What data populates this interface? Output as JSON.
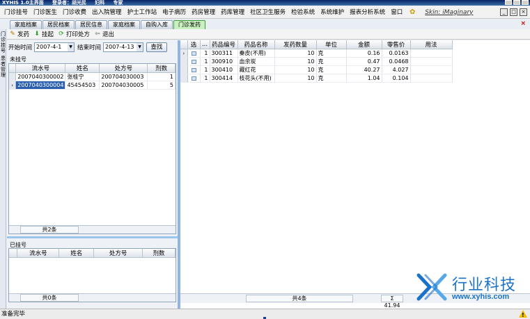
{
  "window": {
    "title": "XYHIS 1.0主界面",
    "user": "登录者：胡光民",
    "dept": "妇科",
    "role": "专家"
  },
  "menu": [
    "门诊挂号",
    "门诊医生",
    "门诊收费",
    "出入院管理",
    "护士工作站",
    "电子病历",
    "药房管理",
    "药库管理",
    "社区卫生服务",
    "检验系统",
    "系统维护",
    "报表分析系统",
    "窗口"
  ],
  "skin": "Skin: iMaginary",
  "tabs": [
    "家庭档案",
    "居民档案",
    "居民信息",
    "家庭档案",
    "自购入库",
    "门诊发药"
  ],
  "leftstrip": [
    "门诊挂号",
    "患者管理"
  ],
  "toolbar": {
    "dispense": "发药",
    "hold": "挂起",
    "print": "打印处方",
    "exit": "退出"
  },
  "search": {
    "start_label": "开始时间",
    "start_value": "2007-4-1",
    "end_label": "结束时间",
    "end_value": "2007-4-13",
    "button": "查找"
  },
  "unregistered": {
    "title": "未挂号",
    "columns": [
      "流水号",
      "姓名",
      "处方号",
      "剂数"
    ],
    "rows": [
      [
        "2007040300002",
        "张桂宁",
        "200704030003",
        "1"
      ],
      [
        "2007040300004",
        "45454503",
        "200704030005",
        "5"
      ]
    ],
    "count": "共2条"
  },
  "registered": {
    "title": "已挂号",
    "columns": [
      "流水号",
      "姓名",
      "处方号",
      "剂数"
    ],
    "count": "共0条"
  },
  "detail": {
    "columns": [
      "选",
      "...",
      "药品编号",
      "药品名称",
      "发药数量",
      "单位",
      "金额",
      "零售价",
      "用法"
    ],
    "rows": [
      [
        "1",
        "300311",
        "秦皮(不用)",
        "10",
        "克",
        "0.16",
        "0.0163",
        ""
      ],
      [
        "1",
        "300910",
        "血余炭",
        "10",
        "克",
        "0.47",
        "0.0468",
        ""
      ],
      [
        "1",
        "300410",
        "藏红花",
        "10",
        "克",
        "40.27",
        "4.027",
        ""
      ],
      [
        "1",
        "300414",
        "枝花头(不用)",
        "10",
        "克",
        "1.04",
        "0.104",
        ""
      ]
    ],
    "count": "共4条",
    "total": "Σ 41.94"
  },
  "logo": {
    "cn": "行业科技",
    "url": "www.xyhis.com"
  },
  "status": "准备完毕"
}
